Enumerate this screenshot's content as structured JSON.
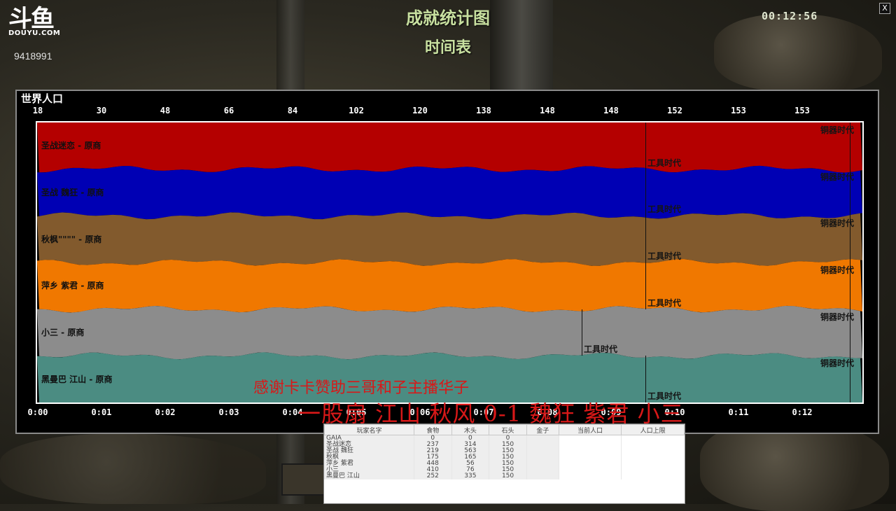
{
  "stream": {
    "logo_mark": "斗鱼",
    "logo_sub": "DOUYU.COM",
    "room_id": "9418991"
  },
  "window": {
    "title": "成就统计图",
    "subtitle": "时间表",
    "clock": "00:12:56",
    "close_label": "X"
  },
  "chart_data": {
    "type": "area",
    "title": "世界人口",
    "top_ticks": [
      "18",
      "30",
      "48",
      "66",
      "84",
      "102",
      "120",
      "138",
      "148",
      "148",
      "152",
      "153",
      "153"
    ],
    "bottom_ticks": [
      "0:00",
      "0:01",
      "0:02",
      "0:03",
      "0:04",
      "0:05",
      "0:06",
      "0:07",
      "0:08",
      "0:09",
      "0:10",
      "0:11",
      "0:12"
    ],
    "series": [
      {
        "name": "圣战迷恋 - 原商",
        "color": "#b40000",
        "age_events": [
          {
            "label": "工具时代",
            "time": "0:10"
          },
          {
            "label": "铜器时代",
            "time": "0:12"
          }
        ]
      },
      {
        "name": "圣战 魏狂 - 原商",
        "color": "#0000b4",
        "age_events": [
          {
            "label": "工具时代",
            "time": "0:10"
          },
          {
            "label": "铜器时代",
            "time": "0:12"
          }
        ]
      },
      {
        "name": "秋枫\"\"\"\" - 原商",
        "color": "#825a2d",
        "age_events": [
          {
            "label": "工具时代",
            "time": "0:10"
          },
          {
            "label": "铜器时代",
            "time": "0:12"
          }
        ]
      },
      {
        "name": "萍乡 紫君 - 原商",
        "color": "#f07800",
        "age_events": [
          {
            "label": "工具时代",
            "time": "0:10"
          },
          {
            "label": "铜器时代",
            "time": "0:12"
          }
        ]
      },
      {
        "name": "小三 - 原商",
        "color": "#8c8c8c",
        "age_events": [
          {
            "label": "工具时代",
            "time": "0:09"
          },
          {
            "label": "铜器时代",
            "time": "0:12"
          }
        ]
      },
      {
        "name": "黑曼巴 江山 - 原商",
        "color": "#4b8c82",
        "age_events": [
          {
            "label": "工具时代",
            "time": "0:10"
          },
          {
            "label": "铜器时代",
            "time": "0:12"
          }
        ]
      }
    ]
  },
  "overlays": {
    "thanks": "感谢卡卡赞助三哥和子主播华子",
    "match": "一股扇 江山 秋风 0-1 魏狂 紫君 小三"
  },
  "stats_table": {
    "headers": [
      "玩家名字",
      "食物",
      "木头",
      "石头",
      "金子",
      "当前人口",
      "人口上限"
    ],
    "rows": [
      [
        "GAIA",
        "0",
        "0",
        "0",
        "",
        "",
        ""
      ],
      [
        "圣战迷恋",
        "237",
        "314",
        "150",
        "",
        "",
        ""
      ],
      [
        "圣战 魏狂",
        "219",
        "563",
        "150",
        "",
        "",
        ""
      ],
      [
        "秋枫",
        "175",
        "165",
        "150",
        "",
        "",
        ""
      ],
      [
        "萍乡 紫君",
        "448",
        "56",
        "150",
        "",
        "",
        ""
      ],
      [
        "小三",
        "410",
        "76",
        "150",
        "",
        "",
        ""
      ],
      [
        "黑曼巴 江山",
        "252",
        "335",
        "150",
        "",
        "",
        ""
      ]
    ]
  }
}
